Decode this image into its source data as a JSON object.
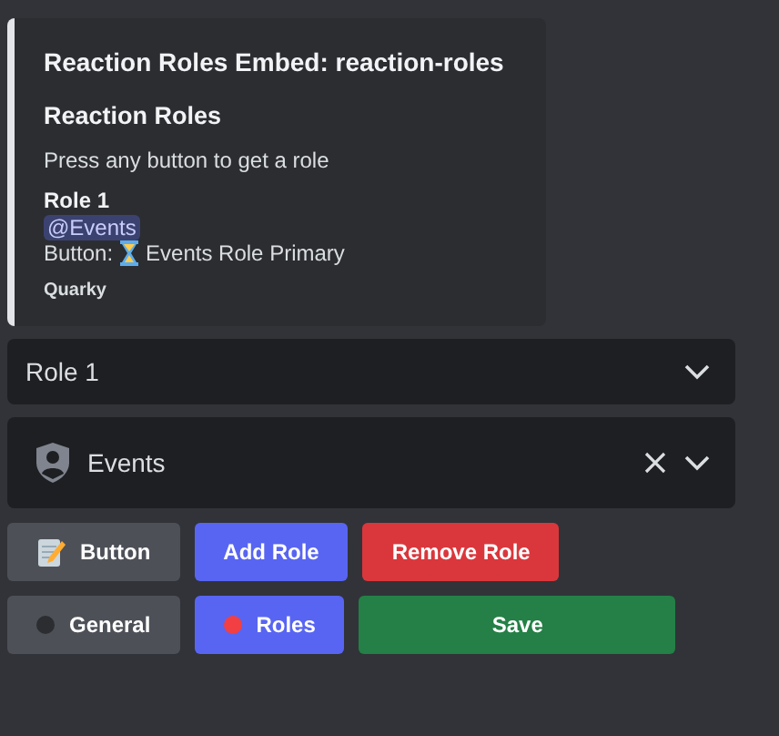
{
  "embed": {
    "title": "Reaction Roles Embed: reaction-roles",
    "heading": "Reaction Roles",
    "description": "Press any button to get a role",
    "field_name": "Role 1",
    "mention": "@Events",
    "button_label": "Button:",
    "button_text": "Events Role Primary",
    "footer": "Quarky"
  },
  "role_select": {
    "value": "Role 1"
  },
  "role_picker": {
    "value": "Events"
  },
  "action_buttons": [
    {
      "label": "Button",
      "kind": "secondary"
    },
    {
      "label": "Add Role",
      "kind": "primary"
    },
    {
      "label": "Remove Role",
      "kind": "danger"
    }
  ],
  "tabs": [
    {
      "label": "General",
      "kind": "secondary",
      "color": "#2b2d31"
    },
    {
      "label": "Roles",
      "kind": "primary",
      "color": "#f23f43"
    },
    {
      "label": "Save",
      "kind": "success"
    }
  ]
}
